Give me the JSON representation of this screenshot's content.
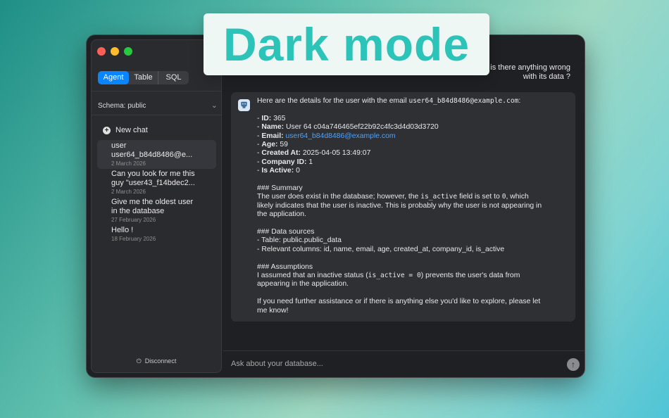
{
  "banner": {
    "text": "Dark mode"
  },
  "sidebar": {
    "tabs": [
      {
        "label": "Agent",
        "active": true
      },
      {
        "label": "Table",
        "active": false
      },
      {
        "label": "SQL",
        "active": false
      }
    ],
    "schema_label": "Schema: public",
    "new_chat_label": "New chat",
    "chats": [
      {
        "title_line1": "user",
        "title_line2": "user64_b84d8486@e...",
        "date": "2 March 2026",
        "selected": true
      },
      {
        "title_line1": "Can you look for me this",
        "title_line2": "guy \"user43_f14bdec2...",
        "date": "2 March 2026",
        "selected": false
      },
      {
        "title_line1": "Give me the oldest user",
        "title_line2": "in the database",
        "date": "27 February 2026",
        "selected": false
      },
      {
        "title_line1": "Hello !",
        "title_line2": "",
        "date": "18 February 2026",
        "selected": false
      }
    ],
    "disconnect_label": "Disconnect"
  },
  "conversation": {
    "user_message_line1": "is there anything wrong",
    "user_message_line2": "with its data ?",
    "assistant": {
      "intro": "Here are the details for the user with the email ",
      "intro_email": "user64_b84d8486@example.com",
      "intro_end": ":",
      "fields": [
        {
          "key": "ID:",
          "value": " 365"
        },
        {
          "key": "Name:",
          "value": " User 64 c04a746465ef22b92c4fc3d4d03d3720"
        },
        {
          "key": "Email:",
          "value": " ",
          "link": "user64_b84d8486@example.com"
        },
        {
          "key": "Age:",
          "value": " 59"
        },
        {
          "key": "Created At:",
          "value": " 2025-04-05 13:49:07"
        },
        {
          "key": "Company ID:",
          "value": " 1"
        },
        {
          "key": "Is Active:",
          "value": " 0"
        }
      ],
      "summary_heading": "### Summary",
      "summary_a": "The user does exist in the database; however, the ",
      "summary_code": "is_active",
      "summary_b": " field is set to ",
      "summary_code2": "0",
      "summary_c": ", which",
      "summary_line2": "likely indicates that the user is inactive. This is probably why the user is not appearing in",
      "summary_line3": "the application.",
      "sources_heading": "### Data sources",
      "sources_1": "- Table: public.public_data",
      "sources_2": "- Relevant columns: id, name, email, age, created_at, company_id, is_active",
      "assumptions_heading": "### Assumptions",
      "assumptions_a": "I assumed that an inactive status (",
      "assumptions_code": "is_active = 0",
      "assumptions_b": ") prevents the user's data from",
      "assumptions_line2": "appearing in the application.",
      "closing_line1": "If you need further assistance or if there is anything else you'd like to explore, please let",
      "closing_line2": "me know!"
    }
  },
  "input": {
    "placeholder": "Ask about your database..."
  },
  "colors": {
    "accent": "#0a84ff",
    "banner_text": "#2cc4b8",
    "link": "#4ea3ff"
  }
}
